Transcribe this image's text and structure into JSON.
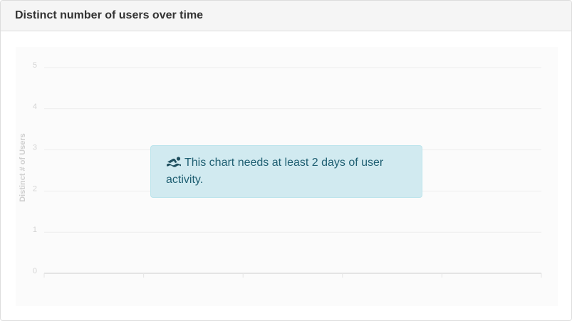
{
  "panel": {
    "title": "Distinct number of users over time"
  },
  "chart_data": {
    "type": "line",
    "title": "",
    "xlabel": "",
    "ylabel": "Distinct # of Users",
    "ylim": [
      0,
      5
    ],
    "yticks": [
      "0",
      "1",
      "2",
      "3",
      "4",
      "5"
    ],
    "x": [],
    "series": [],
    "grid": true
  },
  "alert": {
    "icon": "swimmer-icon",
    "message": "This chart needs at least 2 days of user activity."
  },
  "colors": {
    "alert_bg": "#d1eaf0",
    "alert_text": "#1f5f72",
    "heading_bg": "#f5f5f5"
  }
}
